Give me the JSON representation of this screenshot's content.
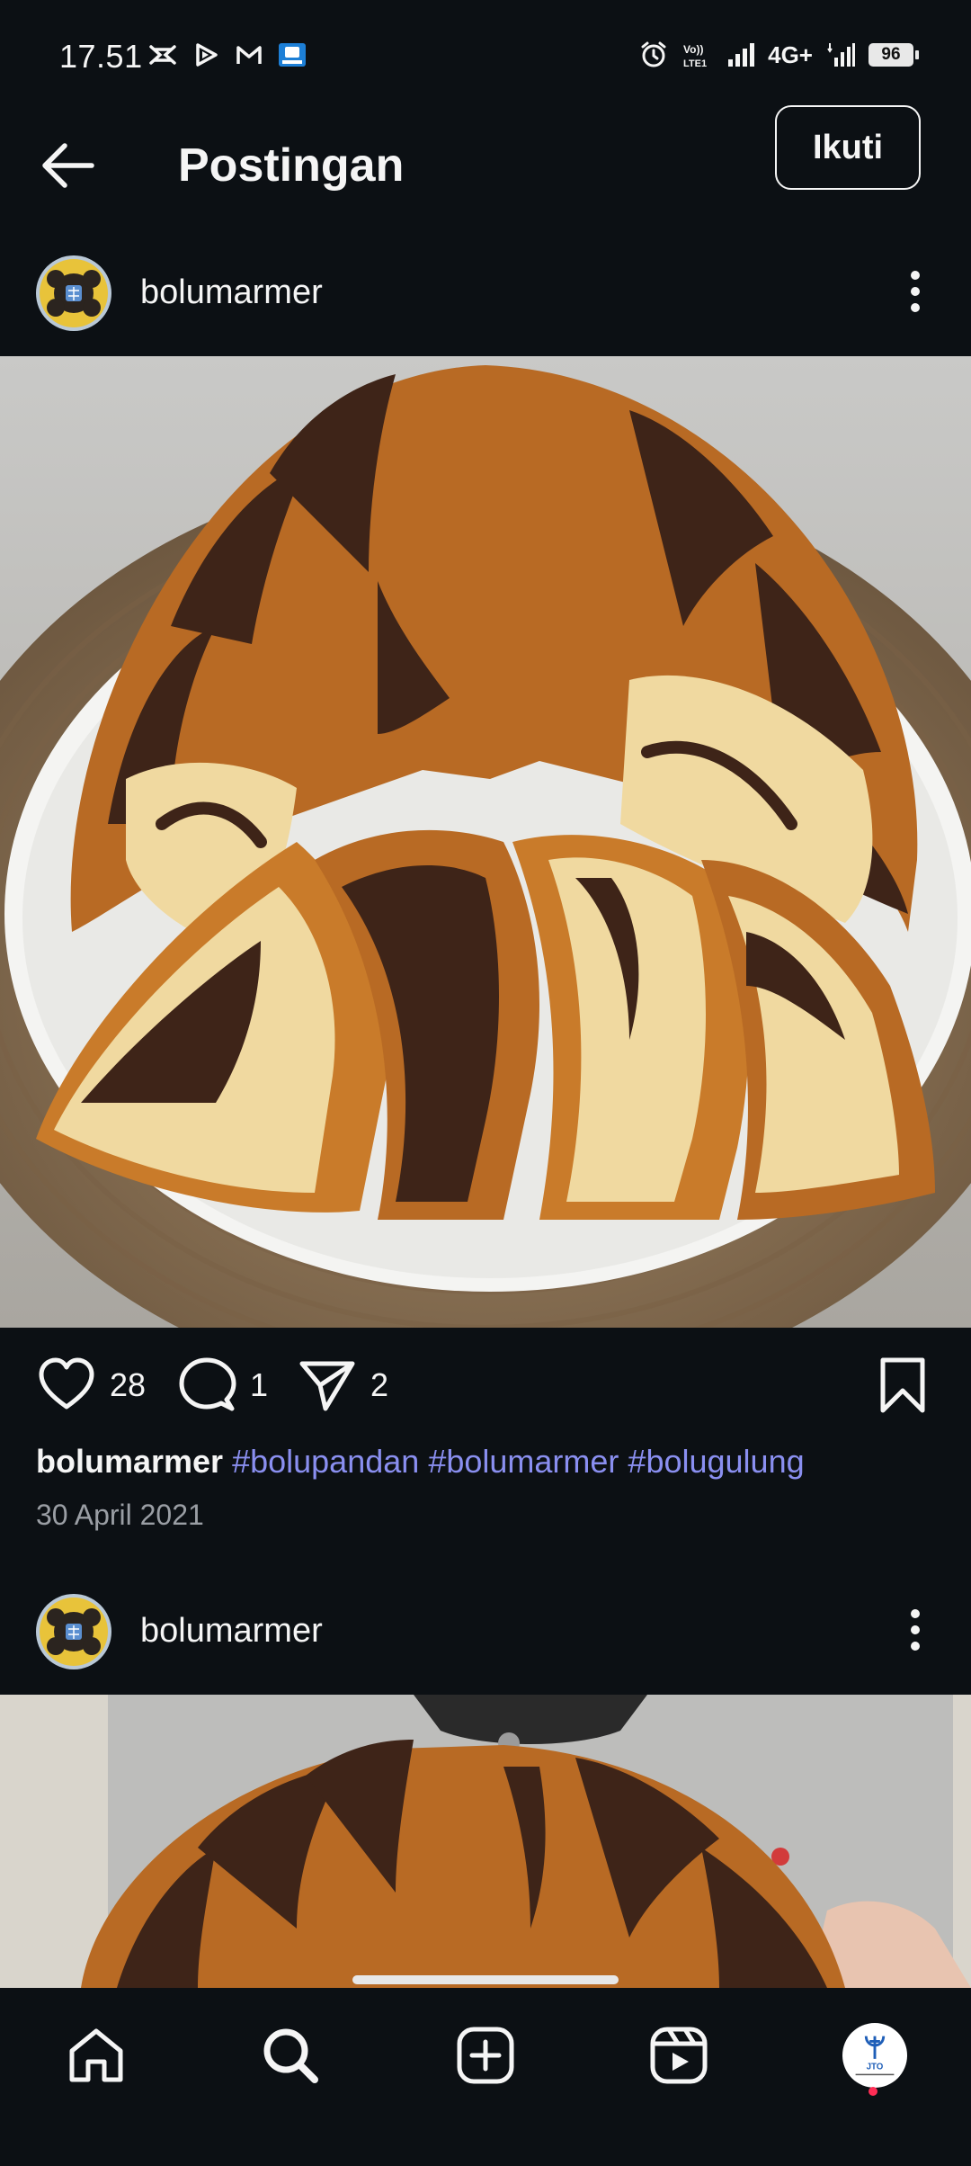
{
  "status_bar": {
    "time": "17.51",
    "network": "4G+",
    "battery": "96"
  },
  "header": {
    "title": "Postingan",
    "follow_label": "Ikuti"
  },
  "posts": [
    {
      "username": "bolumarmer",
      "likes": "28",
      "comments": "1",
      "shares": "2",
      "caption_user": "bolumarmer",
      "hashtags": [
        "#bolupandan",
        "#bolumarmer",
        "#bolugulung"
      ],
      "date": "30 April 2021"
    },
    {
      "username": "bolumarmer"
    }
  ],
  "bottom_nav": {
    "items": [
      "home-icon",
      "search-icon",
      "create-icon",
      "reels-icon",
      "profile-avatar"
    ],
    "profile_text": "JTO"
  },
  "colors": {
    "background": "#0c1014",
    "hashtag": "#8a8ff0",
    "notification_dot": "#ff2d55"
  }
}
